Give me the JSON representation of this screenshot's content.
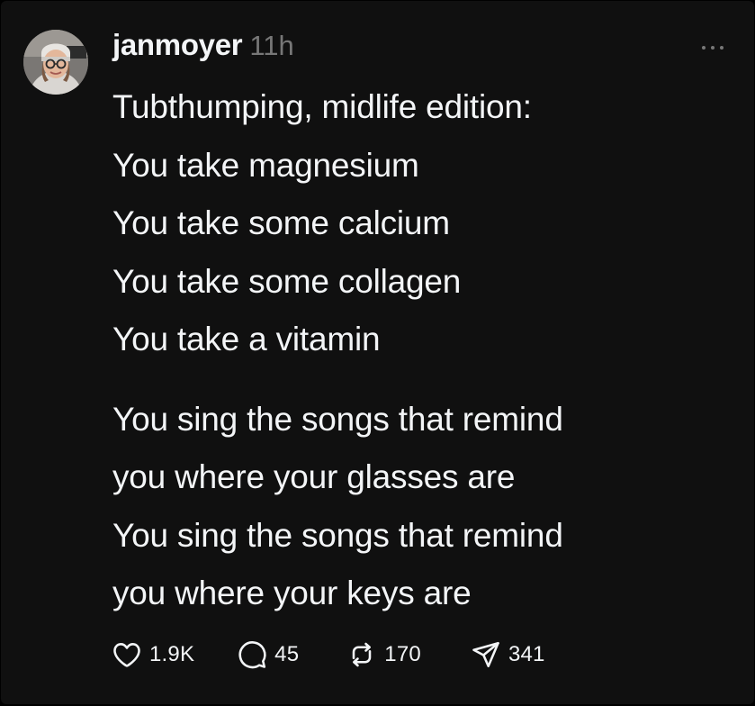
{
  "post": {
    "username": "janmoyer",
    "timestamp": "11h",
    "avatar_icon": "profile-photo",
    "more_icon": "more-horizontal-icon",
    "lines": [
      "Tubthumping, midlife edition:",
      "You take magnesium",
      "You take some calcium",
      "You take some collagen",
      "You take a vitamin"
    ],
    "lines_second_stanza": [
      "You sing the songs that remind",
      "you where your glasses are",
      "You sing the songs that remind",
      "you where your keys are"
    ]
  },
  "actions": {
    "likes": "1.9K",
    "replies": "45",
    "reposts": "170",
    "shares": "341"
  },
  "colors": {
    "background": "#101010",
    "text": "#f3f5f7",
    "muted": "#777777"
  }
}
